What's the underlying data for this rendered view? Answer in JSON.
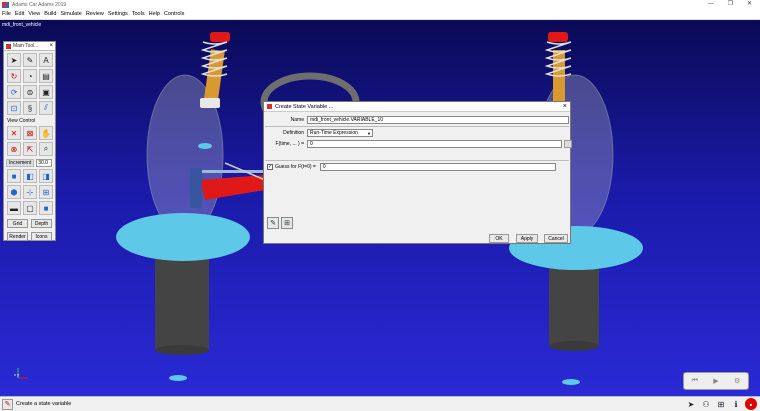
{
  "window": {
    "title": "Adams Car Adams 2019",
    "min": "—",
    "max": "❐",
    "close": "✕"
  },
  "menu": [
    "File",
    "Edit",
    "View",
    "Build",
    "Simulate",
    "Review",
    "Settings",
    "Tools",
    "Help",
    "Controls"
  ],
  "viewport": {
    "model_name": "mdi_front_vehicle",
    "triad": "x  y"
  },
  "toolbox": {
    "title": "Main Tool...",
    "close": "×",
    "view_control_label": "View Control",
    "increment_label": "Increment",
    "increment_value": "30.0",
    "grid_label": "Grid",
    "depth_label": "Depth",
    "render_label": "Render",
    "icons_label": "Icons"
  },
  "dialog": {
    "title": "Create State Variable ...",
    "close": "×",
    "name_label": "Name",
    "name_value": "mdi_front_vehicle.VARIABLE_10",
    "definition_label": "Definition",
    "definition_value": "Run-Time Expression",
    "f_label": "F(time, ... ) =",
    "f_value": "0",
    "guess_label": "Guess for F(t=0) =",
    "guess_checked": "✓",
    "guess_value": "0",
    "ok_label": "OK",
    "apply_label": "Apply",
    "cancel_label": "Cancel"
  },
  "status": {
    "text": "Create a state variable"
  },
  "colors": {
    "viewport_top": "#0a0a55",
    "viewport_bottom": "#2a2ad6",
    "wheel": "#5ec8e8",
    "spring": "#d89a2e",
    "part_red": "#e01818"
  }
}
